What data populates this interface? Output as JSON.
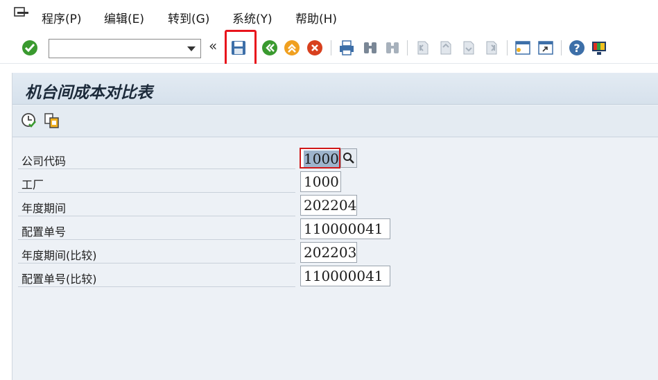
{
  "menu": {
    "items": [
      {
        "label": "程序(P)",
        "name": "menu-program"
      },
      {
        "label": "编辑(E)",
        "name": "menu-edit"
      },
      {
        "label": "转到(G)",
        "name": "menu-goto"
      },
      {
        "label": "系统(Y)",
        "name": "menu-system"
      },
      {
        "label": "帮助(H)",
        "name": "menu-help"
      }
    ]
  },
  "toolbar": {
    "command_field_value": "",
    "collapse_symbol": "«"
  },
  "page": {
    "title": "机台间成本对比表"
  },
  "form": {
    "fields": [
      {
        "label": "公司代码",
        "value": "1000"
      },
      {
        "label": "工厂",
        "value": "1000"
      },
      {
        "label": "年度期间",
        "value": "202204"
      },
      {
        "label": "配置单号",
        "value": "110000041"
      },
      {
        "label": "年度期间(比较)",
        "value": "202203"
      },
      {
        "label": "配置单号(比较)",
        "value": "110000041"
      }
    ]
  },
  "colors": {
    "highlight": "#e8141c",
    "panel_bg": "#edf1f6",
    "title_bar": "#d6e1ec"
  }
}
